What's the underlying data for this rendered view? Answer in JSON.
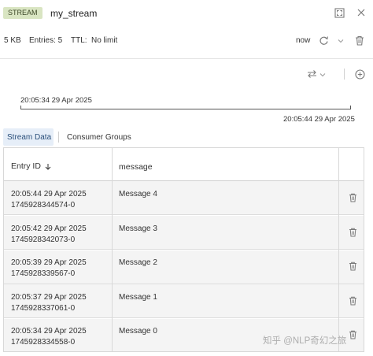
{
  "header": {
    "badge": "STREAM",
    "key_name": "my_stream"
  },
  "meta": {
    "size": "5 KB",
    "entries": "Entries: 5",
    "ttl_label": "TTL:",
    "ttl_value": "No limit",
    "refresh_label": "now"
  },
  "timeline": {
    "start": "20:05:34 29 Apr 2025",
    "end": "20:05:44 29 Apr 2025"
  },
  "tabs": [
    {
      "label": "Stream Data",
      "active": true
    },
    {
      "label": "Consumer Groups",
      "active": false
    }
  ],
  "table": {
    "columns": [
      "Entry ID",
      "message"
    ],
    "rows": [
      {
        "time": "20:05:44 29 Apr 2025",
        "id": "1745928344574-0",
        "message": "Message 4"
      },
      {
        "time": "20:05:42 29 Apr 2025",
        "id": "1745928342073-0",
        "message": "Message 3"
      },
      {
        "time": "20:05:39 29 Apr 2025",
        "id": "1745928339567-0",
        "message": "Message 2"
      },
      {
        "time": "20:05:37 29 Apr 2025",
        "id": "1745928337061-0",
        "message": "Message 1"
      },
      {
        "time": "20:05:34 29 Apr 2025",
        "id": "1745928334558-0",
        "message": "Message 0"
      }
    ]
  },
  "watermark": "知乎 @NLP奇幻之旅"
}
